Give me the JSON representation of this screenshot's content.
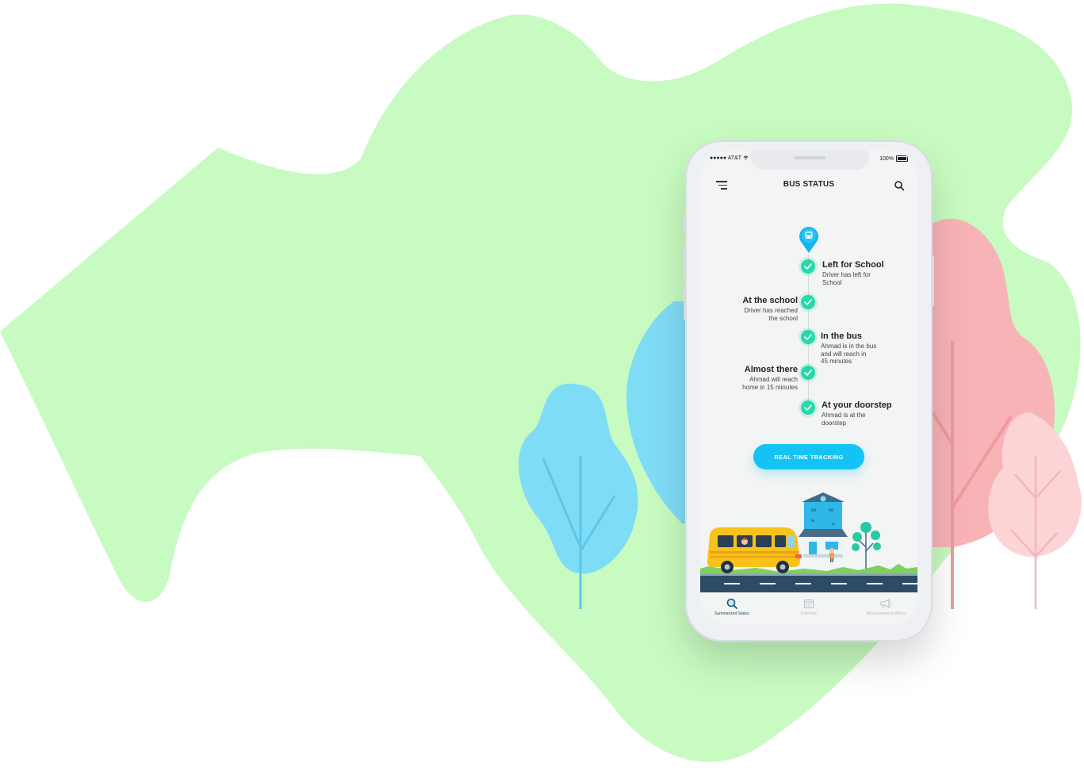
{
  "colors": {
    "blob_green": "#c7fbc1",
    "tree_blue": "#7fdcf6",
    "tree_pink": "#f8b3b7",
    "accent_cyan": "#14c3f3",
    "check_green": "#27d8ac"
  },
  "status_bar": {
    "carrier": "●●●●● AT&T",
    "battery": "100%"
  },
  "header": {
    "title": "BUS STATUS",
    "menu_icon": "menu-icon",
    "search_icon": "search-icon"
  },
  "timeline": {
    "marker_icon": "bus-pin-icon",
    "steps": [
      {
        "title": "Left for School",
        "desc_lines": [
          "Driver has left for",
          "School"
        ],
        "side": "right"
      },
      {
        "title": "At the school",
        "desc_lines": [
          "Driver has reached",
          "the school"
        ],
        "side": "left"
      },
      {
        "title": "In the bus",
        "desc_lines": [
          "Ahmad is in the bus",
          "and will reach in",
          "45 minutes"
        ],
        "side": "right"
      },
      {
        "title": "Almost there",
        "desc_lines": [
          "Ahmad will reach",
          "home in 15 minutes"
        ],
        "side": "left"
      },
      {
        "title": "At your doorstep",
        "desc_lines": [
          "Ahmad is at the",
          "doorstep"
        ],
        "side": "right"
      }
    ]
  },
  "cta": {
    "label": "REAL TIME TRACKING"
  },
  "bottom_nav": [
    {
      "label": "Summarized Status",
      "icon": "summarized-status-icon",
      "active": true
    },
    {
      "label": "Calendar",
      "icon": "calendar-icon",
      "active": false
    },
    {
      "label": "Announcement/ Alerts",
      "icon": "megaphone-icon",
      "active": false
    }
  ]
}
